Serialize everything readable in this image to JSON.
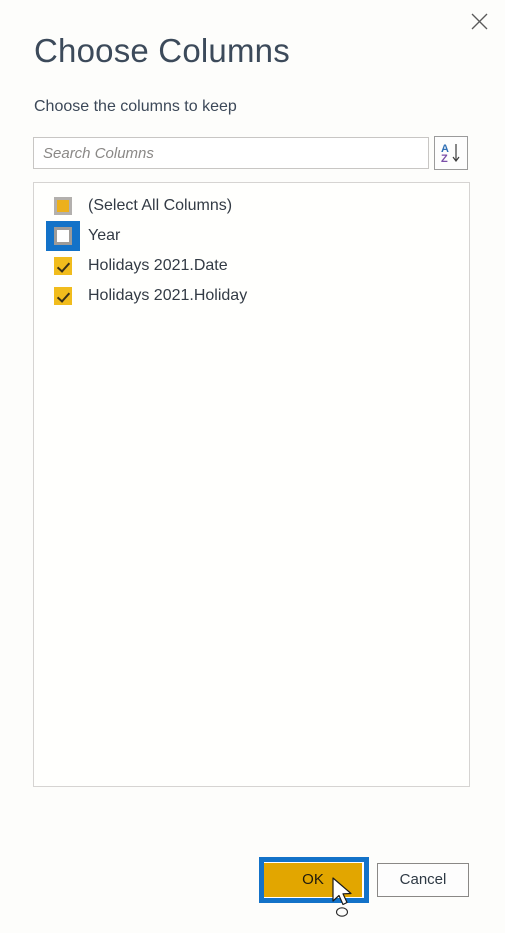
{
  "dialog": {
    "title": "Choose Columns",
    "subtitle": "Choose the columns to keep",
    "close_label": "×"
  },
  "search": {
    "value": "",
    "placeholder": "Search Columns",
    "sort_button_label": "A↓Z",
    "sort_letter_top": "A",
    "sort_letter_bottom": "Z"
  },
  "column_list": {
    "rows": [
      {
        "label": "(Select All Columns)",
        "state": "partial",
        "focused": false
      },
      {
        "label": "Year",
        "state": "unchecked",
        "focused": true
      },
      {
        "label": "Holidays 2021.Date",
        "state": "checked",
        "focused": false
      },
      {
        "label": "Holidays 2021.Holiday",
        "state": "checked",
        "focused": false
      }
    ]
  },
  "footer": {
    "ok_label": "OK",
    "cancel_label": "Cancel"
  },
  "colors": {
    "accent_gold": "#e2a600",
    "checkbox_gold": "#f1bc1c",
    "highlight_blue": "#1372c8",
    "title_text": "#3c4a5a",
    "body_text": "#333b45",
    "border_gray": "#c8c6c4",
    "sort_a_blue": "#2f6fb5",
    "sort_z_purple": "#7a4ea8"
  }
}
